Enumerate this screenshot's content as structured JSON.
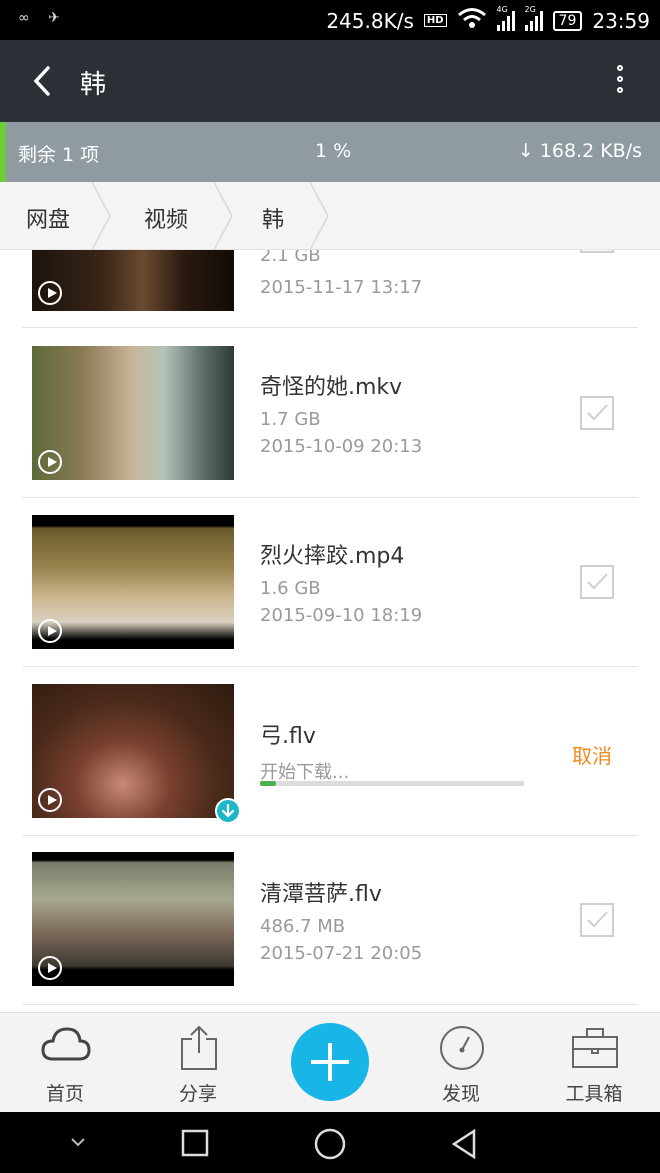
{
  "status_bar": {
    "speed": "245.8K/s",
    "hd": "HD",
    "net_4g": "4G",
    "net_2g": "2G",
    "battery": "79",
    "time": "23:59"
  },
  "header": {
    "title": "韩"
  },
  "transfer": {
    "remaining": "剩余 1 项",
    "percent": "1 %",
    "speed": "↓ 168.2 KB/s"
  },
  "breadcrumb": [
    "网盘",
    "视频",
    "韩"
  ],
  "files": [
    {
      "name": "",
      "size": "2.1 GB",
      "date": "2015-11-17 13:17",
      "checked": true
    },
    {
      "name": "奇怪的她.mkv",
      "size": "1.7 GB",
      "date": "2015-10-09 20:13",
      "checked": true
    },
    {
      "name": "烈火摔跤.mp4",
      "size": "1.6 GB",
      "date": "2015-09-10 18:19",
      "checked": true
    },
    {
      "name": "弓.flv",
      "status": "开始下载...",
      "progress": 0.06,
      "action": "取消"
    },
    {
      "name": "清潭菩萨.flv",
      "size": "486.7 MB",
      "date": "2015-07-21 20:05",
      "checked": true
    }
  ],
  "bottom_nav": {
    "home": "首页",
    "share": "分享",
    "discover": "发现",
    "toolbox": "工具箱"
  },
  "colors": {
    "header_bg": "#2b2f36",
    "transfer_bg": "#8f9aa1",
    "accent_green": "#6dcc37",
    "fab_blue": "#17b6e7",
    "cancel_orange": "#f08a1c"
  }
}
